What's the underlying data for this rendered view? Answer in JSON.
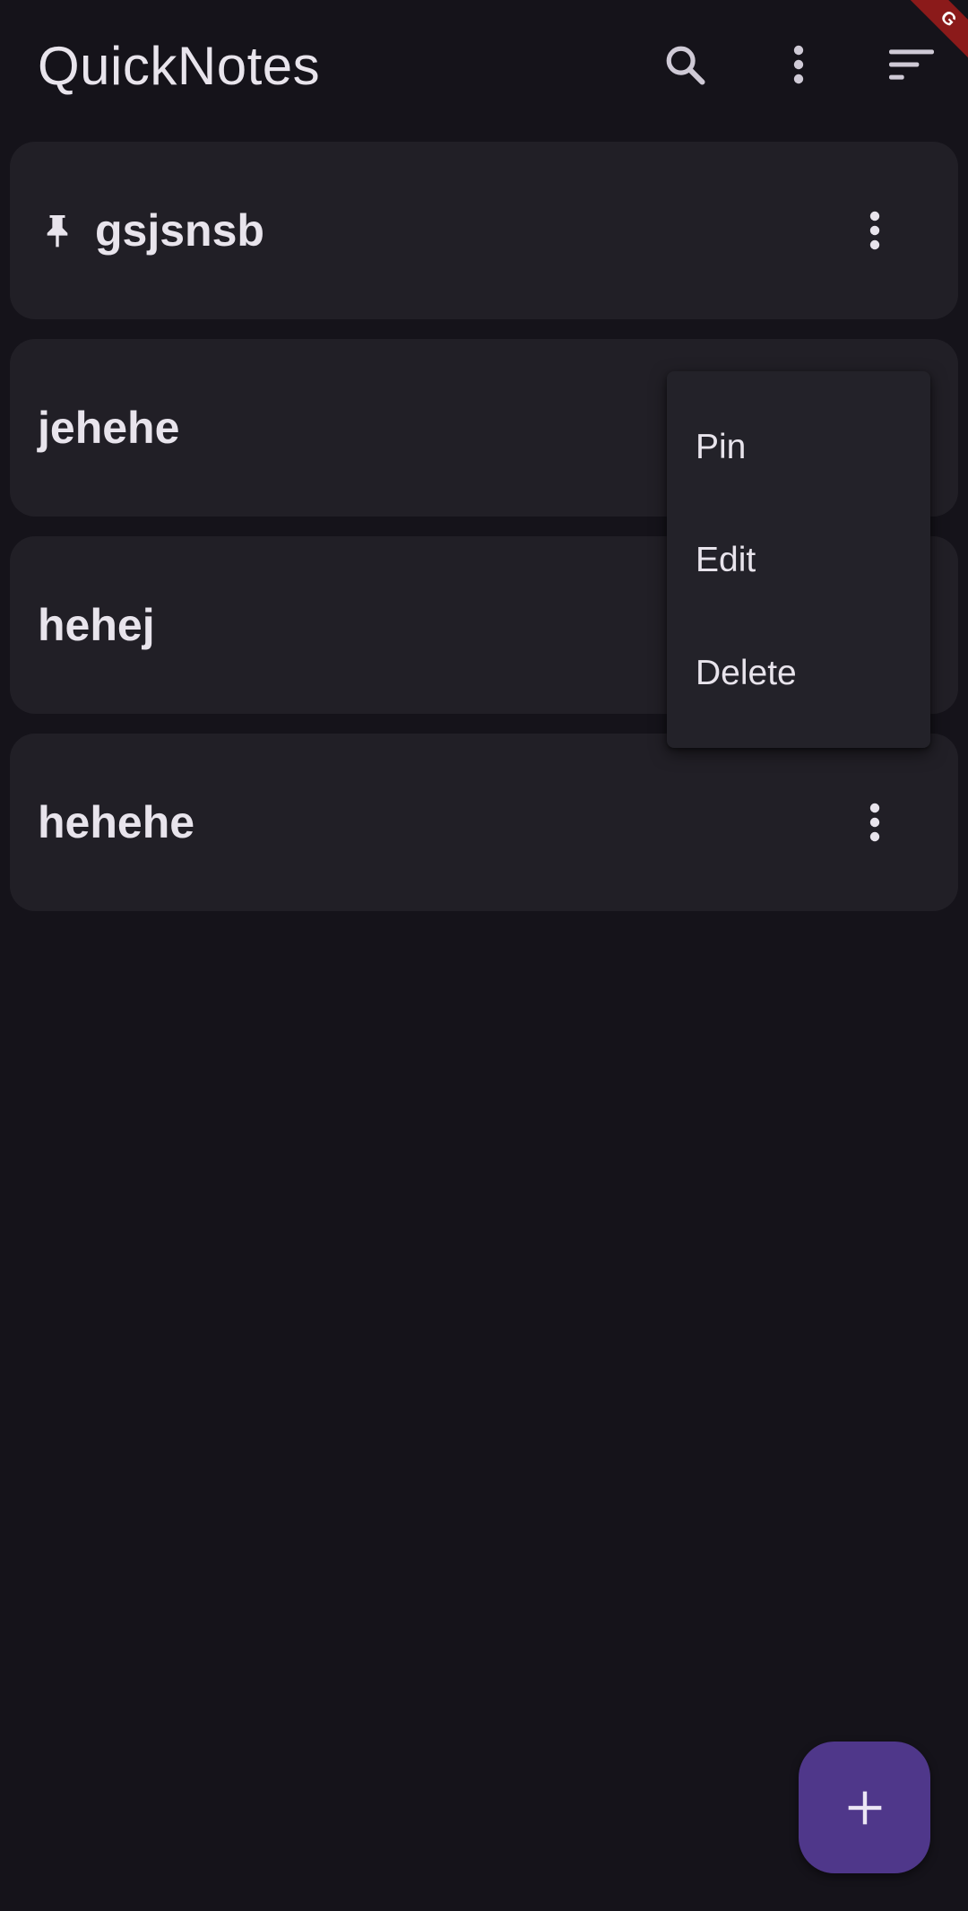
{
  "app_bar": {
    "title": "QuickNotes",
    "actions": [
      {
        "name": "search",
        "icon": "search-icon"
      },
      {
        "name": "more",
        "icon": "more-vert-icon"
      },
      {
        "name": "sort",
        "icon": "sort-icon"
      }
    ]
  },
  "debug_banner": {
    "label": "G"
  },
  "notes": [
    {
      "title": "gsjsnsb",
      "pinned": true
    },
    {
      "title": "jehehe",
      "pinned": false
    },
    {
      "title": "hehej",
      "pinned": false
    },
    {
      "title": "hehehe",
      "pinned": false
    }
  ],
  "popup_menu": {
    "items": [
      "Pin",
      "Edit",
      "Delete"
    ]
  },
  "fab": {
    "icon": "add-icon"
  },
  "colors": {
    "background": "#15131a",
    "card": "#211f26",
    "menu": "#232229",
    "fab": "#4f378a",
    "text": "#e8e4ec",
    "banner": "#8b1a1a"
  }
}
